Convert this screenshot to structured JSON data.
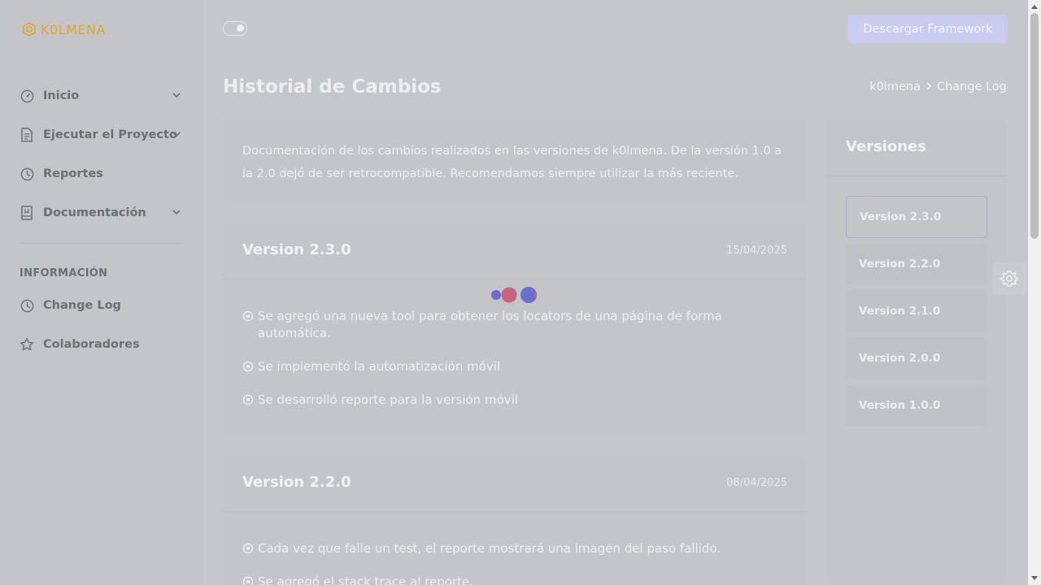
{
  "brand": {
    "name": "K0LMENA"
  },
  "sidebar": {
    "items": [
      {
        "label": "Inicio",
        "icon": "speedometer-icon",
        "has_submenu": true
      },
      {
        "label": "Ejecutar el Proyecto",
        "icon": "document-icon",
        "has_submenu": true
      },
      {
        "label": "Reportes",
        "icon": "clock-icon",
        "has_submenu": false
      },
      {
        "label": "Documentación",
        "icon": "book-icon",
        "has_submenu": true
      }
    ],
    "section_label": "INFORMACIÓN",
    "info_items": [
      {
        "label": "Change Log",
        "icon": "clock-icon"
      },
      {
        "label": "Colaboradores",
        "icon": "star-icon"
      }
    ]
  },
  "topbar": {
    "download_label": "Descargar Framework"
  },
  "page": {
    "title": "Historial de Cambios",
    "breadcrumb": [
      "k0lmena",
      "Change Log"
    ],
    "intro": "Documentación de los cambios realizados en las versiones de k0lmena. De la versión 1.0 a la 2.0 dejó de ser retrocompatible. Recomendamos siempre utilizar la más reciente."
  },
  "versions": [
    {
      "title": "Version 2.3.0",
      "date": "15/04/2025",
      "items": [
        "Se agregó una nueva tool para obtener los locators de una página de forma automática.",
        "Se implementó la automatización móvil",
        "Se desarrolló reporte para la versión móvil"
      ]
    },
    {
      "title": "Version 2.2.0",
      "date": "08/04/2025",
      "items": [
        "Cada vez que falle un test, el reporte mostrará una imagen del paso fallido.",
        "Se agregó el stack trace al reporte."
      ]
    }
  ],
  "versions_panel": {
    "title": "Versiones",
    "items": [
      "Version 2.3.0",
      "Version 2.2.0",
      "Version 2.1.0",
      "Version 2.0.0",
      "Version 1.0.0"
    ],
    "active": "Version 2.3.0"
  },
  "colors": {
    "brand": "#e0a828",
    "accent": "#c9cbef",
    "loader_blue": "#6a6fc9",
    "loader_pink": "#c8647e"
  }
}
